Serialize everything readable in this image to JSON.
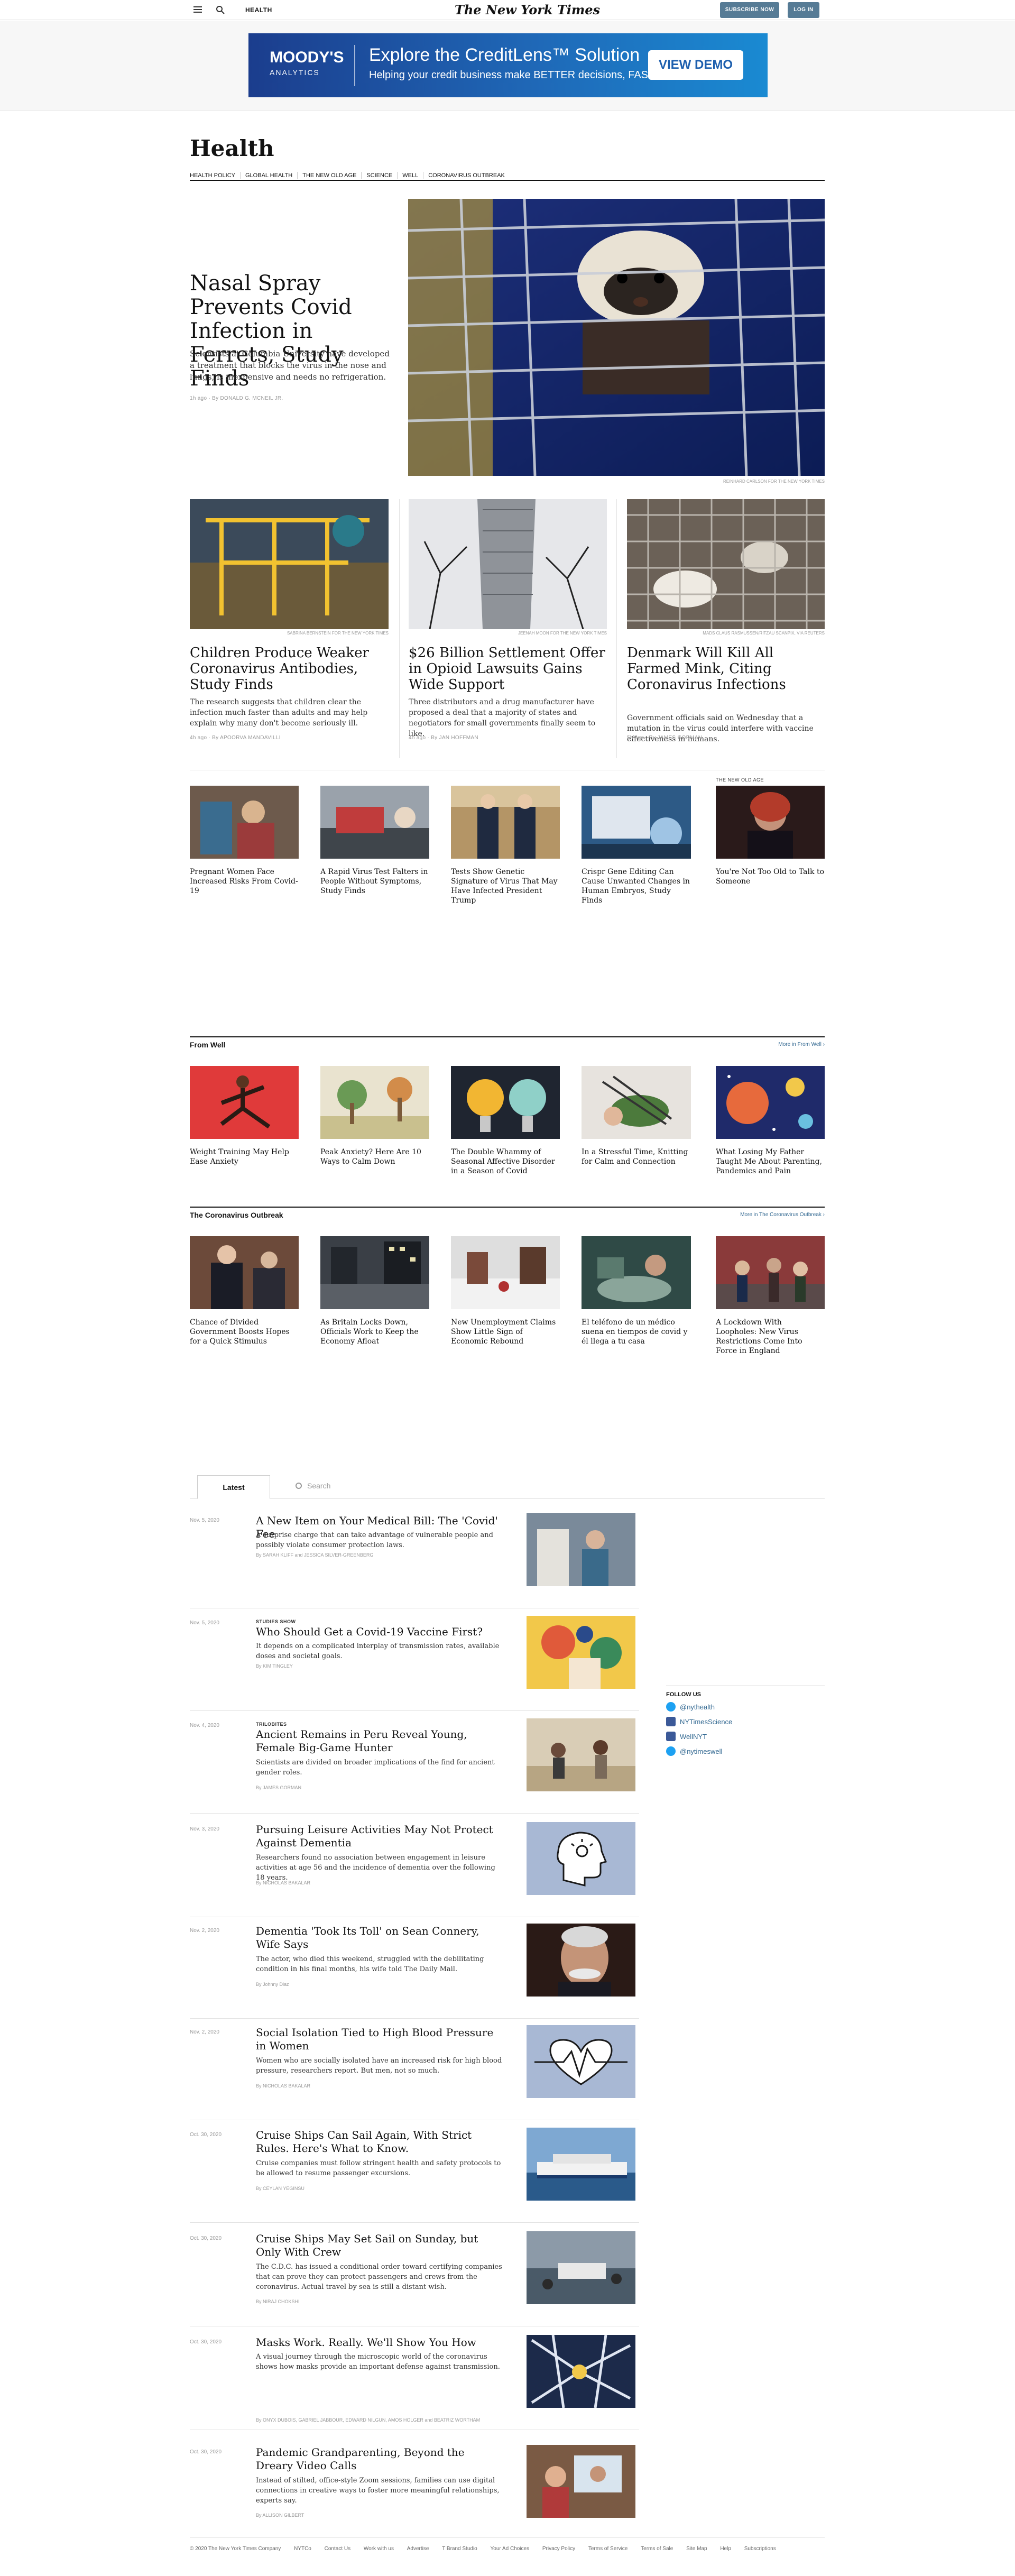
{
  "topbar": {
    "section": "HEALTH",
    "logo": "The New York Times",
    "subscribe": "SUBSCRIBE NOW",
    "login": "LOG IN"
  },
  "ad": {
    "brand_top": "MOODY'S",
    "brand_bottom": "ANALYTICS",
    "headline": "Explore the CreditLens™ Solution",
    "sub": "Helping your credit business make BETTER decisions, FASTER",
    "cta": "VIEW DEMO"
  },
  "masthead": "Health",
  "subnav": [
    "HEALTH POLICY",
    "GLOBAL HEALTH",
    "THE NEW OLD AGE",
    "SCIENCE",
    "WELL",
    "CORONAVIRUS OUTBREAK"
  ],
  "lead": {
    "headline": "Nasal Spray Prevents Covid Infection in Ferrets, Study Finds",
    "summary": "Scientists at Columbia University have developed a treatment that blocks the virus in the nose and lungs, is inexpensive and needs no refrigeration.",
    "byline": "1h ago · By DONALD G. MCNEIL JR.",
    "credit": "REINHARD CARLSON FOR THE NEW YORK TIMES"
  },
  "cards": [
    {
      "headline": "Children Produce Weaker Coronavirus Antibodies, Study Finds",
      "summary": "The research suggests that children clear the infection much faster than adults and may help explain why many don't become seriously ill.",
      "byline": "4h ago · By APOORVA MANDAVILLI",
      "credit": "SABRINA BERNSTEIN FOR THE NEW YORK TIMES"
    },
    {
      "headline": "$26 Billion Settlement Offer in Opioid Lawsuits Gains Wide Support",
      "summary": "Three distributors and a drug manufacturer have proposed a deal that a majority of states and negotiators for small governments finally seem to like.",
      "byline": "4h ago · By JAN HOFFMAN",
      "credit": "JEENAH MOON FOR THE NEW YORK TIMES"
    },
    {
      "headline": "Denmark Will Kill All Farmed Mink, Citing Coronavirus Infections",
      "summary": "Government officials said on Wednesday that a mutation in the virus could interfere with vaccine effectiveness in humans.",
      "byline": "5h ago · By JAMES GORMAN",
      "credit": "MADS CLAUS RASMUSSEN/RITZAU SCANPIX, VIA REUTERS"
    }
  ],
  "strip": {
    "kicker": "THE NEW OLD AGE",
    "items": [
      "Pregnant Women Face Increased Risks From Covid-19",
      "A Rapid Virus Test Falters in People Without Symptoms, Study Finds",
      "Tests Show Genetic Signature of Virus That May Have Infected President Trump",
      "Crispr Gene Editing Can Cause Unwanted Changes in Human Embryos, Study Finds",
      "You're Not Too Old to Talk to Someone"
    ]
  },
  "well": {
    "title": "From Well",
    "more": "More in From Well ›",
    "items": [
      "Weight Training May Help Ease Anxiety",
      "Peak Anxiety? Here Are 10 Ways to Calm Down",
      "The Double Whammy of Seasonal Affective Disorder in a Season of Covid",
      "In a Stressful Time, Knitting for Calm and Connection",
      "What Losing My Father Taught Me About Parenting, Pandemics and Pain"
    ]
  },
  "corona": {
    "title": "The Coronavirus Outbreak",
    "more": "More in The Coronavirus Outbreak ›",
    "items": [
      "Chance of Divided Government Boosts Hopes for a Quick Stimulus",
      "As Britain Locks Down, Officials Work to Keep the Economy Afloat",
      "New Unemployment Claims Show Little Sign of Economic Rebound",
      "El teléfono de un médico suena en tiempos de covid y él llega a tu casa",
      "A Lockdown With Loopholes: New Virus Restrictions Come Into Force in England"
    ]
  },
  "latest": {
    "tab": "Latest",
    "search_placeholder": "Search",
    "rows": [
      {
        "date": "Nov. 5, 2020",
        "kicker": "",
        "headline": "A New Item on Your Medical Bill: The 'Covid' Fee",
        "summary": "A surprise charge that can take advantage of vulnerable people and possibly violate consumer protection laws.",
        "byline": "By SARAH KLIFF and JESSICA SILVER-GREENBERG"
      },
      {
        "date": "Nov. 5, 2020",
        "kicker": "STUDIES SHOW",
        "headline": "Who Should Get a Covid-19 Vaccine First?",
        "summary": "It depends on a complicated interplay of transmission rates, available doses and societal goals.",
        "byline": "By KIM TINGLEY"
      },
      {
        "date": "Nov. 4, 2020",
        "kicker": "TRILOBITES",
        "headline": "Ancient Remains in Peru Reveal Young, Female Big-Game Hunter",
        "summary": "Scientists are divided on broader implications of the find for ancient gender roles.",
        "byline": "By JAMES GORMAN"
      },
      {
        "date": "Nov. 3, 2020",
        "kicker": "",
        "headline": "Pursuing Leisure Activities May Not Protect Against Dementia",
        "summary": "Researchers found no association between engagement in leisure activities at age 56 and the incidence of dementia over the following 18 years.",
        "byline": "By NICHOLAS BAKALAR"
      },
      {
        "date": "Nov. 2, 2020",
        "kicker": "",
        "headline": "Dementia 'Took Its Toll' on Sean Connery, Wife Says",
        "summary": "The actor, who died this weekend, struggled with the debilitating condition in his final months, his wife told The Daily Mail.",
        "byline": "By Johnny Diaz"
      },
      {
        "date": "Nov. 2, 2020",
        "kicker": "",
        "headline": "Social Isolation Tied to High Blood Pressure in Women",
        "summary": "Women who are socially isolated have an increased risk for high blood pressure, researchers report. But men, not so much.",
        "byline": "By NICHOLAS BAKALAR"
      },
      {
        "date": "Oct. 30, 2020",
        "kicker": "",
        "headline": "Cruise Ships Can Sail Again, With Strict Rules. Here's What to Know.",
        "summary": "Cruise companies must follow stringent health and safety protocols to be allowed to resume passenger excursions.",
        "byline": "By CEYLAN YEGINSU"
      },
      {
        "date": "Oct. 30, 2020",
        "kicker": "",
        "headline": "Cruise Ships May Set Sail on Sunday, but Only With Crew",
        "summary": "The C.D.C. has issued a conditional order toward certifying companies that can prove they can protect passengers and crews from the coronavirus. Actual travel by sea is still a distant wish.",
        "byline": "By NIRAJ CHOKSHI"
      },
      {
        "date": "Oct. 30, 2020",
        "kicker": "",
        "headline": "Masks Work. Really. We'll Show You How",
        "summary": "A visual journey through the microscopic world of the coronavirus shows how masks provide an important defense against transmission.",
        "byline": "By ONYX DUBOIS, GABRIEL JABBOUR, EDWARD NILGUN, AMOS HOLGER and BEATRIZ WORTHAM"
      },
      {
        "date": "Oct. 30, 2020",
        "kicker": "",
        "headline": "Pandemic Grandparenting, Beyond the Dreary Video Calls",
        "summary": "Instead of stilted, office-style Zoom sessions, families can use digital connections in creative ways to foster more meaningful relationships, experts say.",
        "byline": "By ALLISON GILBERT"
      }
    ]
  },
  "follow": {
    "title": "FOLLOW US",
    "items": [
      "@nythealth",
      "NYTimesScience",
      "WellNYT",
      "@nytimeswell"
    ],
    "colors": {
      "twitter": "#1da1f2",
      "facebook": "#3b5998"
    }
  },
  "footer": [
    "© 2020 The New York Times Company",
    "NYTCo",
    "Contact Us",
    "Work with us",
    "Advertise",
    "T Brand Studio",
    "Your Ad Choices",
    "Privacy Policy",
    "Terms of Service",
    "Terms of Sale",
    "Site Map",
    "Help",
    "Subscriptions"
  ]
}
